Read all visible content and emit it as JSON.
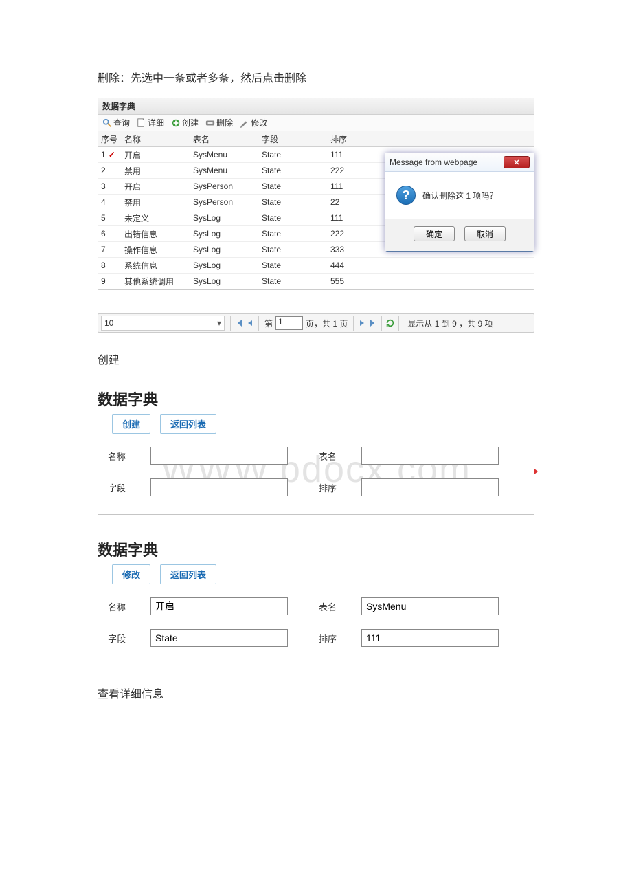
{
  "instr1": "删除：先选中一条或者多条，然后点击删除",
  "gridTitle": "数据字典",
  "toolbar": {
    "query": "查询",
    "detail": "详细",
    "create": "创建",
    "delete": "删除",
    "modify": "修改"
  },
  "cols": {
    "c0": "序号",
    "c1": "名称",
    "c2": "表名",
    "c3": "字段",
    "c4": "排序"
  },
  "rows": [
    {
      "n": "1",
      "name": "开启",
      "table": "SysMenu",
      "field": "State",
      "sort": "111",
      "sel": true
    },
    {
      "n": "2",
      "name": "禁用",
      "table": "SysMenu",
      "field": "State",
      "sort": "222",
      "sel": false
    },
    {
      "n": "3",
      "name": "开启",
      "table": "SysPerson",
      "field": "State",
      "sort": "111",
      "sel": false
    },
    {
      "n": "4",
      "name": "禁用",
      "table": "SysPerson",
      "field": "State",
      "sort": "22",
      "sel": false
    },
    {
      "n": "5",
      "name": "未定义",
      "table": "SysLog",
      "field": "State",
      "sort": "111",
      "sel": false
    },
    {
      "n": "6",
      "name": "出错信息",
      "table": "SysLog",
      "field": "State",
      "sort": "222",
      "sel": false
    },
    {
      "n": "7",
      "name": "操作信息",
      "table": "SysLog",
      "field": "State",
      "sort": "333",
      "sel": false
    },
    {
      "n": "8",
      "name": "系统信息",
      "table": "SysLog",
      "field": "State",
      "sort": "444",
      "sel": false
    },
    {
      "n": "9",
      "name": "其他系统调用",
      "table": "SysLog",
      "field": "State",
      "sort": "555",
      "sel": false
    }
  ],
  "dialog": {
    "title": "Message from webpage",
    "msg": "确认删除这 1 项吗？",
    "ok": "确定",
    "cancel": "取消"
  },
  "pager": {
    "size": "10",
    "pagePrefix": "第",
    "page": "1",
    "pageMid": "页，共",
    "totalPages": "1",
    "pageSuffix": "页",
    "info": "显示从 1 到 9 ，共 9 项"
  },
  "createHeading": "创建",
  "sectionTitle": "数据字典",
  "watermark": "WWW.bdocx.com",
  "createForm": {
    "tabMain": "创建",
    "tabBack": "返回列表",
    "lblName": "名称",
    "lblTable": "表名",
    "lblField": "字段",
    "lblSort": "排序",
    "name": "",
    "table": "",
    "field": "",
    "sort": ""
  },
  "editForm": {
    "tabMain": "修改",
    "tabBack": "返回列表",
    "lblName": "名称",
    "lblTable": "表名",
    "lblField": "字段",
    "lblSort": "排序",
    "name": "开启",
    "table": "SysMenu",
    "field": "State",
    "sort": "111"
  },
  "viewHeading": "查看详细信息"
}
